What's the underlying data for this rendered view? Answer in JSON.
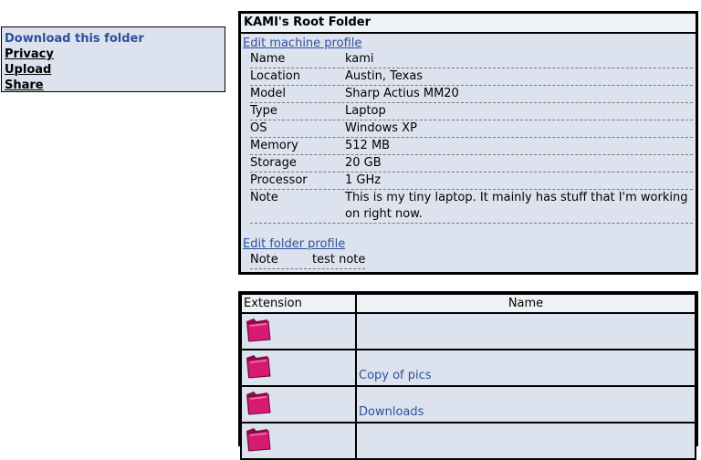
{
  "left_panel": {
    "download": "Download this folder",
    "privacy": "Privacy",
    "upload": "Upload",
    "share": "Share"
  },
  "profile": {
    "title": "KAMI's Root Folder",
    "edit_machine": "Edit machine profile",
    "machine": [
      {
        "key": "Name",
        "value": "kami"
      },
      {
        "key": "Location",
        "value": "Austin, Texas"
      },
      {
        "key": "Model",
        "value": "Sharp Actius MM20"
      },
      {
        "key": "Type",
        "value": "Laptop"
      },
      {
        "key": "OS",
        "value": "Windows XP"
      },
      {
        "key": "Memory",
        "value": "512 MB"
      },
      {
        "key": "Storage",
        "value": "20 GB"
      },
      {
        "key": "Processor",
        "value": "1 GHz"
      },
      {
        "key": "Note",
        "value": "This is my tiny laptop. It mainly has stuff that I'm working on right now."
      }
    ],
    "edit_folder": "Edit folder profile",
    "folder": [
      {
        "key": "Note",
        "value": "test note"
      }
    ]
  },
  "files": {
    "headers": {
      "extension": "Extension",
      "name": "Name"
    },
    "rows": [
      {
        "name": ""
      },
      {
        "name": "Copy of pics"
      },
      {
        "name": "Downloads"
      },
      {
        "name": ""
      }
    ]
  },
  "colors": {
    "panel_bg": "#dde3ee",
    "link": "#2f4f9c",
    "folder": "#d81b72"
  }
}
